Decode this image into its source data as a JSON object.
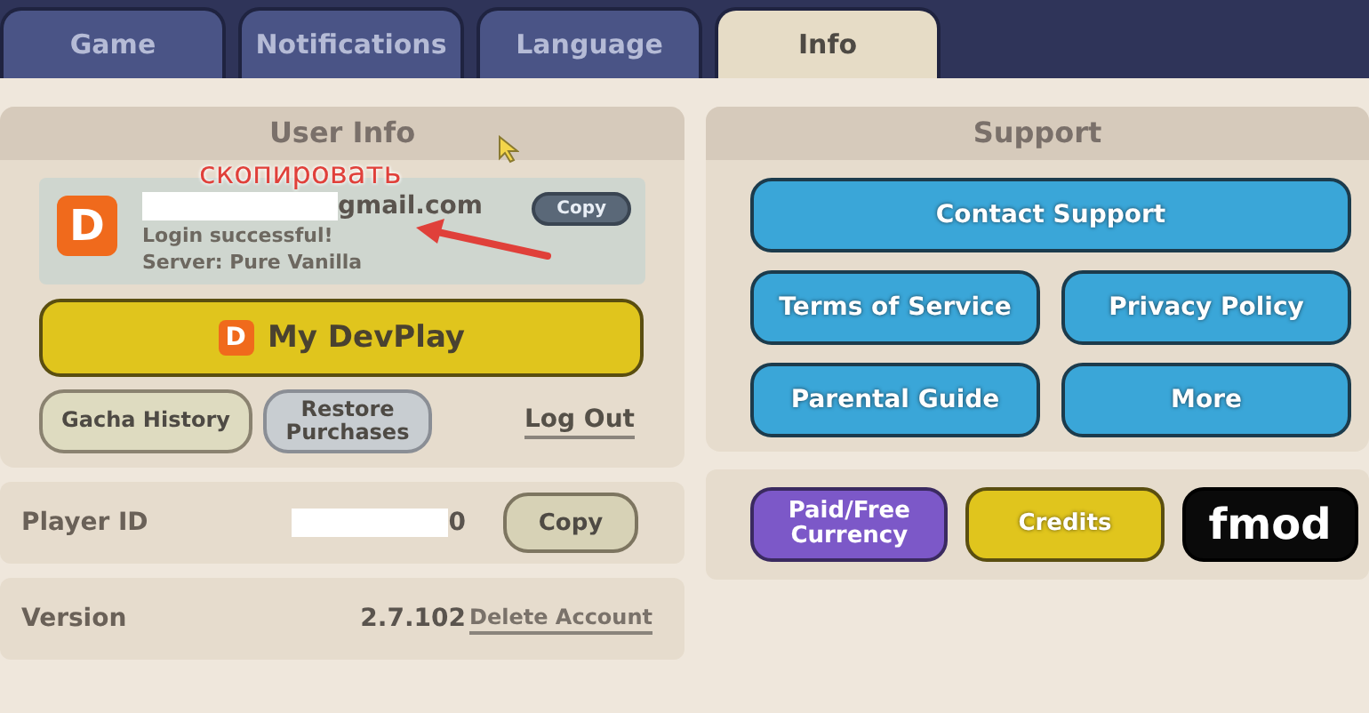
{
  "tabs": [
    {
      "label": "Game",
      "selected": false
    },
    {
      "label": "Notifications",
      "selected": false
    },
    {
      "label": "Language",
      "selected": false
    },
    {
      "label": "Info",
      "selected": true
    }
  ],
  "user_info": {
    "title": "User Info",
    "email": "gmail.com",
    "status": "Login successful!",
    "server": "Server: Pure Vanilla",
    "copy_button": "Copy",
    "logo_letter": "D",
    "devplay_logo_letter": "D",
    "devplay_button": "My DevPlay",
    "buttons": [
      {
        "label": "Gacha History",
        "kind": "tan"
      },
      {
        "label": "Restore Purchases",
        "kind": "grey"
      }
    ],
    "logout_link": "Log Out"
  },
  "player_id": {
    "label": "Player ID",
    "value": "0",
    "copy_button": "Copy"
  },
  "version": {
    "label": "Version",
    "value": "2.7.102",
    "delete_link": "Delete Account"
  },
  "annotation": {
    "text": "скопировать"
  },
  "support": {
    "title": "Support",
    "buttons": [
      "Contact Support",
      "Terms of Service",
      "Privacy Policy",
      "Parental Guide",
      "More"
    ],
    "bottom_buttons": [
      {
        "label": "Paid/Free Currency",
        "kind": "purple"
      },
      {
        "label": "Credits",
        "kind": "yellow"
      },
      {
        "label": "fmod",
        "kind": "logo"
      }
    ]
  }
}
